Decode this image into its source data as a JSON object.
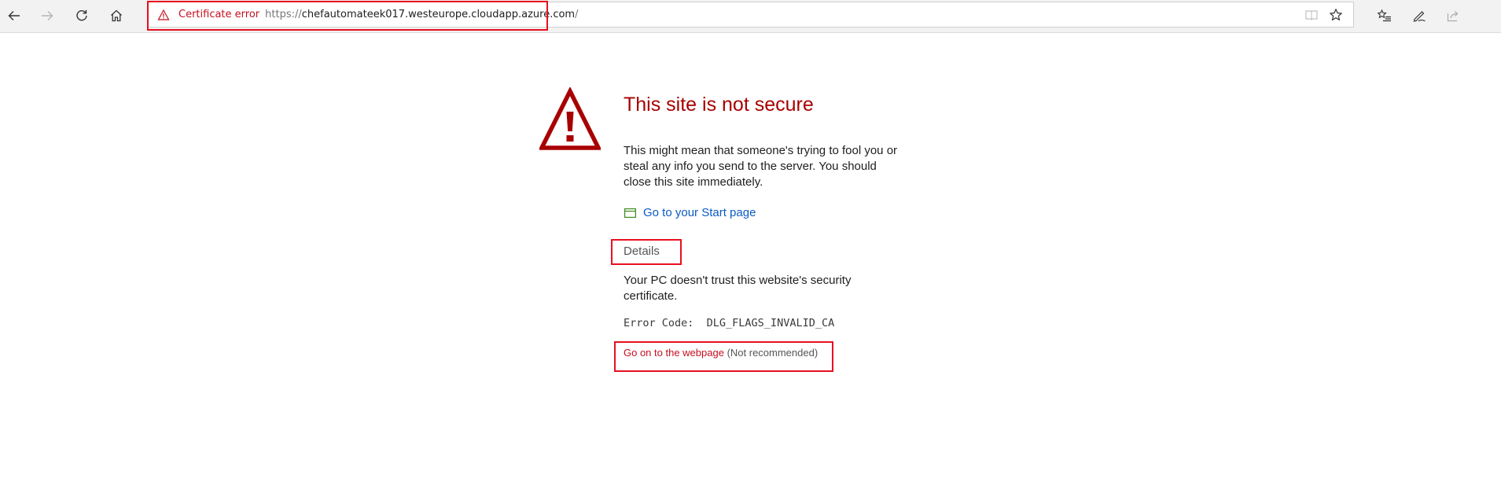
{
  "toolbar": {
    "back": "back-arrow-icon",
    "forward": "forward-arrow-icon",
    "refresh": "refresh-icon",
    "home": "home-icon"
  },
  "address_bar": {
    "certificate_label": "Certificate error",
    "url_scheme": "https://",
    "url_host": "chefautomateek017.westeurope.cloudapp.azure.com",
    "url_path": "/",
    "icons": [
      "reading-view-icon",
      "favorite-star-icon"
    ]
  },
  "right_toolbar": {
    "icons": [
      "favorites-list-icon",
      "pen-notes-icon",
      "share-icon"
    ]
  },
  "page": {
    "title": "This site is not secure",
    "description": "This might mean that someone's trying to fool you or steal any info you send to the server. You should close this site immediately.",
    "start_link": "Go to your Start page",
    "details_label": "Details",
    "details_text": "Your PC doesn't trust this website's security certificate.",
    "error_code": "Error Code:  DLG_FLAGS_INVALID_CA",
    "proceed_link": "Go on to the webpage",
    "proceed_note": "(Not recommended)"
  },
  "colors": {
    "warning_red": "#a80000",
    "link_blue": "#0a5bc4",
    "annotation_red": "#e8101f",
    "start_icon_green": "#3c8a1e"
  }
}
